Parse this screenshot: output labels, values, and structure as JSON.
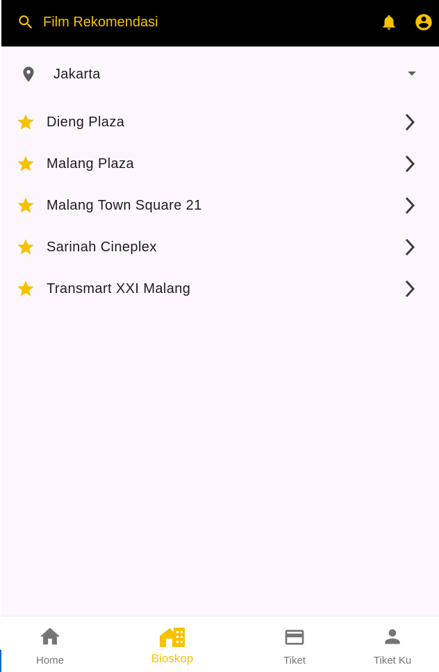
{
  "app_bar": {
    "title": "Film Rekomendasi",
    "search_icon": "search-icon",
    "bell_icon": "bell-icon",
    "account_icon": "account-circle-icon"
  },
  "location": {
    "city": "Jakarta",
    "icon": "location-pin-icon",
    "dropdown_icon": "arrow-drop-down-icon"
  },
  "cinemas": [
    {
      "name": "Dieng Plaza"
    },
    {
      "name": "Malang Plaza"
    },
    {
      "name": "Malang Town Square 21"
    },
    {
      "name": "Sarinah Cineplex"
    },
    {
      "name": "Transmart XXI Malang"
    }
  ],
  "bottom_nav": {
    "items": [
      {
        "label": "Home",
        "icon": "home-icon"
      },
      {
        "label": "Bioskop",
        "icon": "cinema-building-icon",
        "active": true
      },
      {
        "label": "Tiket",
        "icon": "ticket-card-icon"
      },
      {
        "label": "Tiket Ku",
        "icon": "person-icon"
      }
    ]
  },
  "colors": {
    "accent": "#f6c200",
    "app_bar_bg": "#000000",
    "background": "#fdf7fd",
    "text": "#1e1b20",
    "inactive": "#757575"
  }
}
